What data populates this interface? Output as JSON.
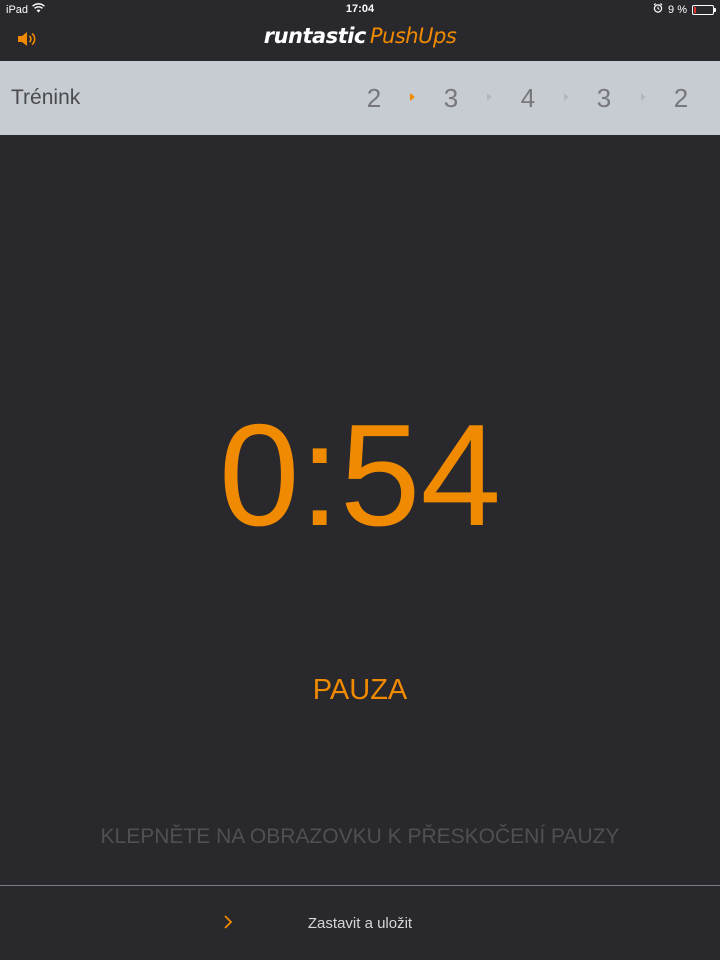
{
  "status_bar": {
    "device": "iPad",
    "time": "17:04",
    "battery_percent": "9 %",
    "battery_level": 0.09,
    "icons": [
      "wifi-icon",
      "alarm-icon",
      "battery-icon"
    ]
  },
  "header": {
    "brand": "runtastic",
    "product": "PushUps",
    "sound_icon": "speaker-icon"
  },
  "training": {
    "label": "Trénink",
    "sets": [
      "2",
      "3",
      "4",
      "3",
      "2"
    ],
    "active_separator_index": 0
  },
  "timer": {
    "value": "0:54",
    "state_label": "PAUZA",
    "hint": "KLEPNĚTE NA OBRAZOVKU K PŘESKOČENÍ PAUZY"
  },
  "footer": {
    "action_label": "Zastavit a uložit",
    "action_icon": "chevron-right-icon"
  },
  "colors": {
    "accent": "#f08a00",
    "background": "#29282c",
    "training_bar": "#c6ccd2"
  }
}
